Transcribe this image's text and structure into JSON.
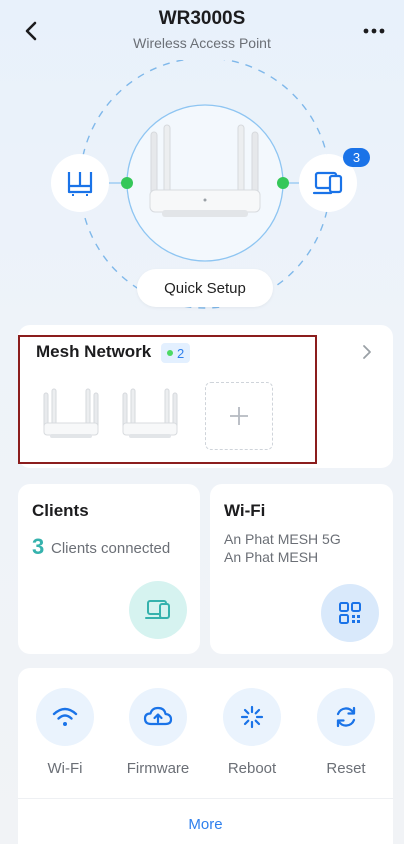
{
  "header": {
    "title": "WR3000S",
    "subtitle": "Wireless Access Point"
  },
  "hero": {
    "connected_devices_badge": "3",
    "quick_setup_label": "Quick Setup",
    "status_dot_color": "#35c759"
  },
  "mesh": {
    "title": "Mesh Network",
    "node_count": "2"
  },
  "clients": {
    "title": "Clients",
    "count": "3",
    "label": "Clients connected"
  },
  "wifi": {
    "title": "Wi-Fi",
    "ssids": [
      "An Phat MESH 5G",
      "An Phat MESH"
    ]
  },
  "tools": {
    "items": [
      {
        "label": "Wi-Fi",
        "icon": "wifi-icon"
      },
      {
        "label": "Firmware",
        "icon": "cloud-upload-icon"
      },
      {
        "label": "Reboot",
        "icon": "reboot-icon"
      },
      {
        "label": "Reset",
        "icon": "reset-icon"
      }
    ],
    "more_label": "More"
  },
  "colors": {
    "accent": "#2f80ed",
    "teal": "#35b2ad",
    "icon_blue": "#1a73e8"
  }
}
